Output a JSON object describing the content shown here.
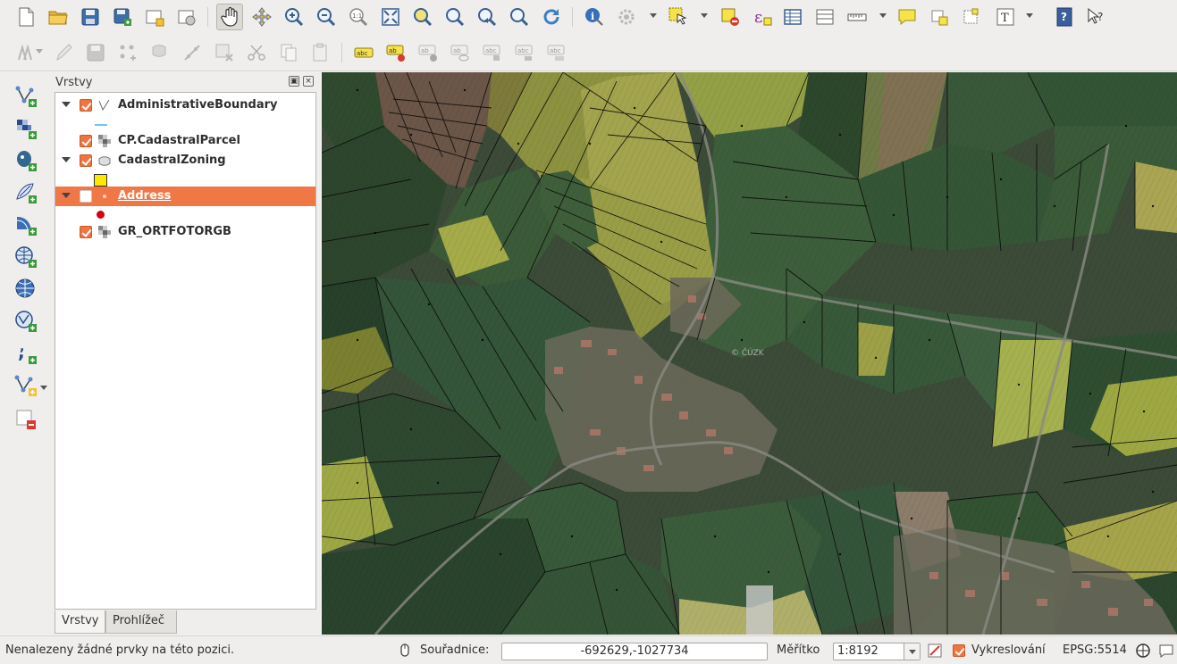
{
  "toolbar_top": {
    "icons": [
      "new-project-icon",
      "open-project-icon",
      "save-project-icon",
      "save-as-icon",
      "new-print-composer-icon",
      "composer-manager-icon",
      "pan-icon",
      "pan-to-selection-icon",
      "zoom-in-icon",
      "zoom-out-icon",
      "zoom-native-icon",
      "zoom-full-icon",
      "zoom-to-selection-icon",
      "zoom-to-layer-icon",
      "zoom-last-icon",
      "zoom-next-icon",
      "refresh-icon",
      "identify-icon",
      "action-icon",
      "select-features-icon",
      "deselect-icon",
      "field-calculator-icon",
      "attribute-table-icon",
      "statistics-icon",
      "measure-icon",
      "map-tips-icon",
      "new-bookmark-icon",
      "show-bookmarks-icon",
      "text-annotation-icon",
      "help-icon",
      "whats-this-icon"
    ]
  },
  "toolbar_digitize": {
    "icons": [
      "current-edits-icon",
      "toggle-editing-icon",
      "save-layer-edits-icon",
      "add-feature-icon",
      "move-feature-icon",
      "node-tool-icon",
      "delete-selected-icon",
      "cut-features-icon",
      "copy-features-icon",
      "paste-features-icon",
      "label-icon",
      "label-pin-icon",
      "label-show-icon",
      "label-move-icon",
      "label-rotate-icon",
      "label-change-icon"
    ]
  },
  "left_toolbar": {
    "icons": [
      "add-vector-layer-icon",
      "add-raster-layer-icon",
      "add-postgis-layer-icon",
      "add-spatialite-layer-icon",
      "add-mssql-layer-icon",
      "add-wms-layer-icon",
      "add-wcs-layer-icon",
      "add-wfs-layer-icon",
      "add-delimited-text-icon",
      "new-shapefile-icon",
      "remove-layer-icon"
    ]
  },
  "layers_panel": {
    "title": "Vrstvy",
    "layers": [
      {
        "name": "AdministrativeBoundary",
        "checked": true,
        "expanded": true,
        "type": "line",
        "symbol_color": "#6fc6f2"
      },
      {
        "name": "CP.CadastralParcel",
        "checked": true,
        "expanded": false,
        "type": "raster"
      },
      {
        "name": "CadastralZoning",
        "checked": true,
        "expanded": true,
        "type": "polygon",
        "symbol_color": "#ffe800"
      },
      {
        "name": "Address",
        "checked": false,
        "expanded": true,
        "type": "point",
        "selected": true,
        "symbol_color": "#d8000f"
      },
      {
        "name": "GR_ORTFOTORGB",
        "checked": true,
        "expanded": false,
        "type": "raster"
      }
    ],
    "tabs": [
      {
        "label": "Vrstvy",
        "active": true
      },
      {
        "label": "Prohlížeč",
        "active": false
      }
    ]
  },
  "map": {
    "watermark": "© ČÚZK"
  },
  "statusbar": {
    "message": "Nenalezeny žádné prvky na této pozici.",
    "coordinate_label": "Souřadnice:",
    "coordinate_value": "-692629,-1027734",
    "scale_label": "Měřítko",
    "scale_value": "1:8192",
    "render_label": "Vykreslování",
    "render_checked": true,
    "crs": "EPSG:5514"
  }
}
